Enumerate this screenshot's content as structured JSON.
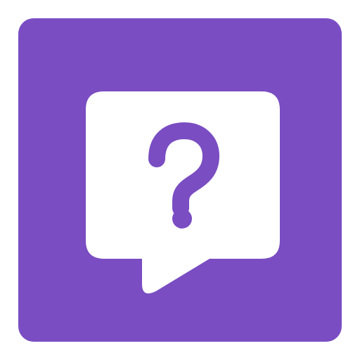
{
  "app_icon": {
    "name": "help-chat-question",
    "icon": "speech-bubble-question-mark-icon",
    "colors": {
      "background": "#7a4dc2",
      "bubble": "#ffffff",
      "glyph": "#7a4dc2"
    }
  }
}
